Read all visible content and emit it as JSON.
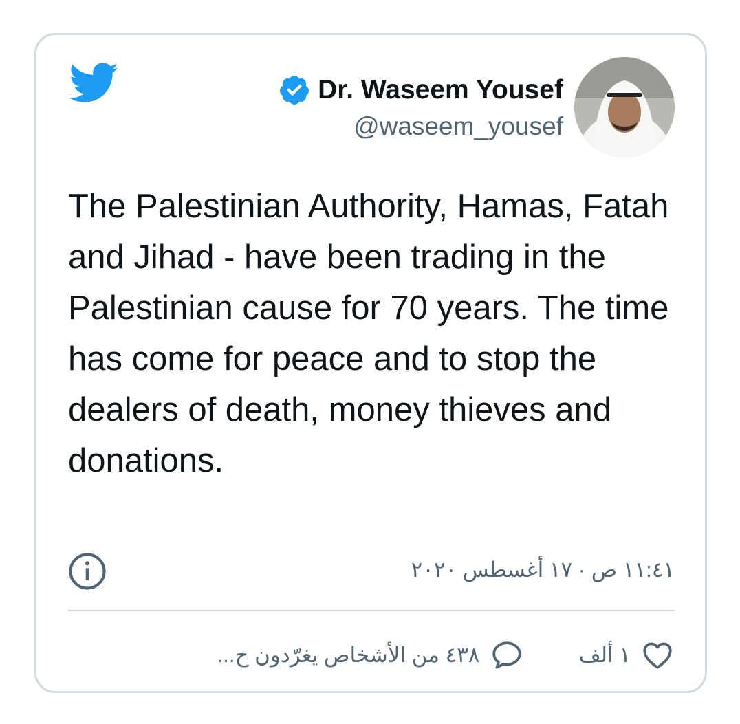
{
  "author": {
    "display_name": "Dr. Waseem Yousef",
    "handle": "@waseem_yousef",
    "verified": true
  },
  "icons": {
    "logo": "twitter-bird-icon",
    "verified": "verified-badge-icon",
    "info": "info-icon",
    "like": "heart-icon",
    "reply": "reply-bubble-icon"
  },
  "tweet": {
    "text": "The Palestinian Authority, Hamas, Fatah and Jihad - have been trading in the Palestinian cause for 70 years. The time has come for peace and to stop the dealers of death, money thieves and donations.",
    "timestamp": "١١:٤١ ص · ١٧ أغسطس ٢٠٢٠"
  },
  "actions": {
    "like_count": "١ ألف",
    "reply_label": "٤٣٨ من الأشخاص يغرّدون ح..."
  },
  "colors": {
    "brand": "#1d9bf0",
    "text": "#0f1419",
    "secondary": "#536471",
    "border": "#cfd9de"
  }
}
